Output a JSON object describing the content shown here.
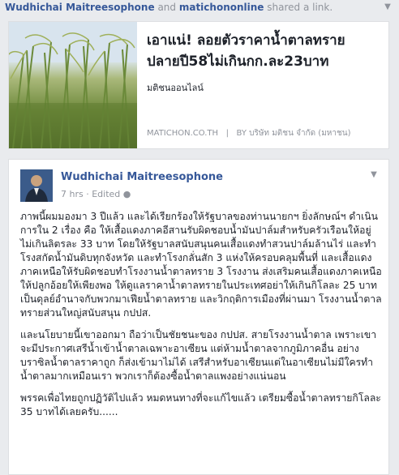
{
  "share_line": {
    "user1": "Wudhichai Maitreesophone",
    "and": "and",
    "user2": "matichononline",
    "action": "shared a link."
  },
  "link_preview": {
    "title": "เอาแน่! ลอยตัวราคาน้ำตาลทราย ปลายปี58ไม่เกินกก.ละ23บาท",
    "source_name": "มติชนออนไลน์",
    "domain": "MATICHON.CO.TH",
    "by": "BY บริษัท มติชน จำกัด (มหาชน)",
    "separator": "|"
  },
  "post": {
    "author": "Wudhichai Maitreesophone",
    "time": "7 hrs",
    "dot": "·",
    "edited": "Edited",
    "paragraphs": [
      "ภาพนี้ผมมองมา 3 ปีแล้ว และได้เรียกร้องให้รัฐบาลของท่านนายกฯ ยิ่งลักษณ์ฯ ดำเนินการใน 2 เรื่อง คือ ให้เสื้อแดงภาคอีสานรับผิดชอบน้ำมันปาล์มสำหรับครัวเรือนให้อยู่ไม่เกินลิตรละ 33 บาท โดยให้รัฐบาลสนับสนุนคนเสื้อแดงทำสวนปาล์มล้านไร่ และทำโรงสกัดน้ำมันดิบทุกจังหวัด และทำโรงกลั่นสัก 3 แห่งให้ครอบคลุมพื้นที่ และเสื้อแดงภาคเหนือให้รับผิดชอบทำโรงงานน้ำตาลทราย 3 โรงงาน ส่งเสริมคนเสื้อแดงภาคเหนือให้ปลูกอ้อยให้เพียงพอ ให้ดูแลราคาน้ำตาลทรายในประเทศอย่าให้เกินกิโลละ 25 บาท เป็นดุลย์อำนาจกับพวกมาเฟียน้ำตาลทราย และวิกฤติการเมืองที่ผ่านมา โรงงานน้ำตาลทรายส่วนใหญ่สนับสนุน กปปส.",
      "และนโยบายนี้เขาออกมา ถือว่าเป็นชัยชนะของ กปปส. สายโรงงานน้ำตาล เพราะเขาจะมีประกาศเสรีน้ำเข้าน้ำตาลเฉพาะอาเซียน แต่ห้ามน้ำตาลจากภูมิภาคอื่น อย่างบราซิลน้ำตาลราคาถูก ก็ส่งเข้ามาไม่ได้ เสรีสำหรับอาเซียนแต่ในอาเซียนไม่มีใครทำน้ำตาลมากเหมือนเรา พวกเราก็ต้องซื้อน้ำตาลแพงอย่างแน่นอน",
      "พรรคเพื่อไทยถูกปฏิวัติไปแล้ว หมดหนทางที่จะแก้ไขแล้ว เตรียมซื้อน้ำตาลทรายกิโลละ 35 บาทได้เลยครับ......"
    ]
  }
}
